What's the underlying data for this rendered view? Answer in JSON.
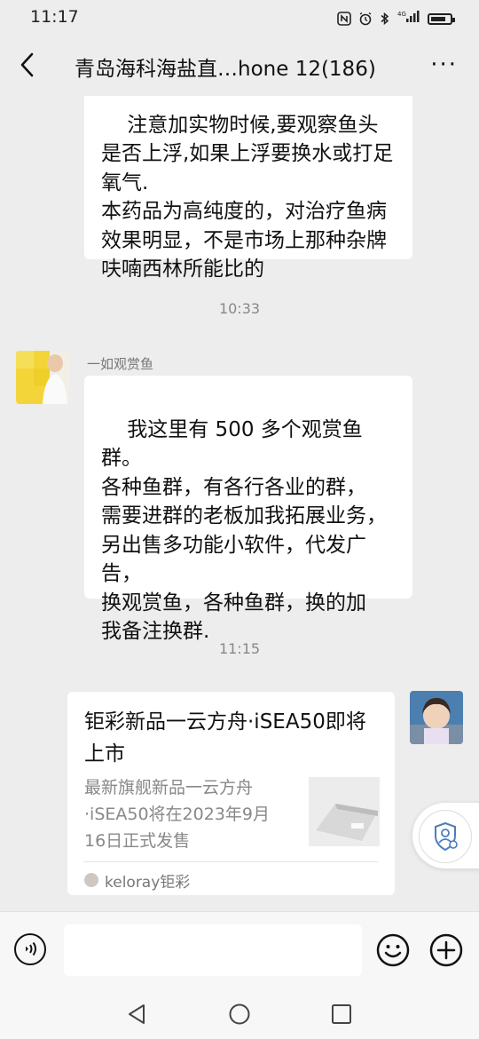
{
  "status_bar": {
    "time": "11:17",
    "icons": [
      "nfc-icon",
      "alarm-icon",
      "bluetooth-icon",
      "signal-4g-icon",
      "battery-icon"
    ],
    "network_label": "4G"
  },
  "header": {
    "title": "青岛海科海盐直…hone 12(186)",
    "back_icon": "chevron-left-icon",
    "more_label": "···"
  },
  "messages": {
    "first": {
      "text": "注意加实物时候,要观察鱼头是否上浮,如果上浮要换水或打足氧气.\n本药品为高纯度的，对治疗鱼病效果明显，不是市场上那种杂牌呋喃西林所能比的"
    },
    "timestamp1": "10:33",
    "second": {
      "sender": "一如观赏鱼",
      "text": "我这里有 500 多个观赏鱼群。\n各种鱼群，有各行各业的群，\n需要进群的老板加我拓展业务，\n另出售多功能小软件，代发广告，\n换观赏鱼，各种鱼群，换的加\n我备注换群."
    },
    "timestamp2": "11:15",
    "link_card": {
      "title": "钜彩新品一云方舟·iSEA50即将上市",
      "description": "最新旗舰新品一云方舟·iSEA50将在2023年9月16日正式发售",
      "source": "keloray钜彩"
    }
  },
  "input_bar": {
    "placeholder": "",
    "voice_icon": "voice-icon",
    "emoji_icon": "emoji-icon",
    "plus_icon": "plus-icon"
  },
  "floating": {
    "icon": "shield-user-icon"
  },
  "colors": {
    "background": "#ededed",
    "bubble": "#ffffff",
    "timestamp": "#888888"
  }
}
